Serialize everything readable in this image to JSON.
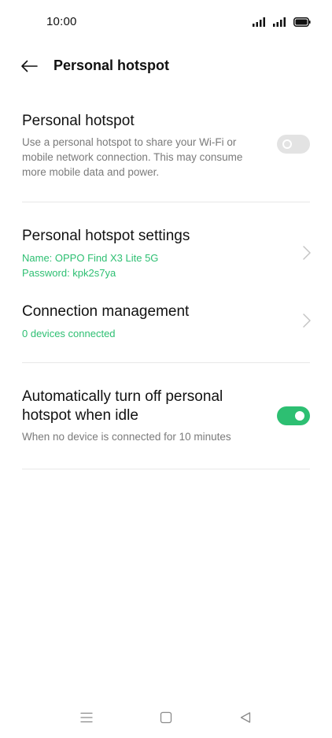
{
  "status_bar": {
    "time": "10:00"
  },
  "header": {
    "title": "Personal hotspot",
    "back_icon": "arrow-left-icon"
  },
  "hotspot": {
    "title": "Personal hotspot",
    "description": "Use a personal hotspot to share your Wi-Fi or mobile network connection. This may consume more mobile data and power.",
    "enabled": false
  },
  "settings": {
    "title": "Personal hotspot settings",
    "name_line": "Name: OPPO Find X3 Lite 5G",
    "password_line": "Password: kpk2s7ya"
  },
  "connection": {
    "title": "Connection management",
    "status": "0 devices connected"
  },
  "auto_off": {
    "title": "Automatically turn off personal hotspot when idle",
    "description": "When no device is connected for 10 minutes",
    "enabled": true
  },
  "colors": {
    "accent": "#2dbf72",
    "toggle_off": "#e3e3e3",
    "secondary_text": "#7a7a7a",
    "divider": "#e8e8e8"
  },
  "nav": {
    "menu_icon": "menu-icon",
    "home_icon": "home-square-icon",
    "back_icon": "back-triangle-icon"
  }
}
